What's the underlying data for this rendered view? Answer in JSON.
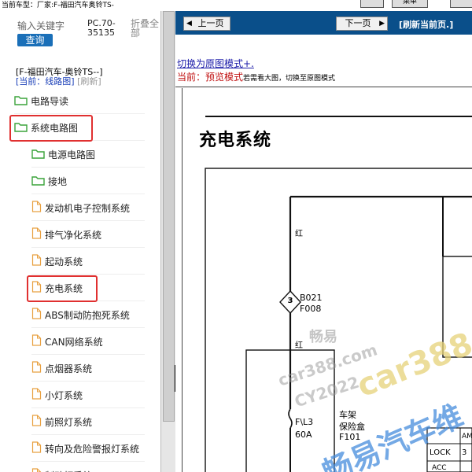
{
  "top": {
    "car_label": "当前车型：厂家:F-福田汽车奥铃TS-",
    "menu_label": "菜单"
  },
  "search": {
    "placeholder": "输入关键字",
    "query_button": "查询"
  },
  "model": {
    "line1": "PC.70-",
    "line2": "35135"
  },
  "fold": {
    "line1": "折叠全",
    "line2": "部"
  },
  "crumb": {
    "line1": "[F-福田汽车-奥铃TS--]",
    "current": "[当前：线路图]",
    "refresh": "[刷新]"
  },
  "tree": [
    {
      "label": "电路导读",
      "icon": "folder-icon"
    },
    {
      "label": "系统电路图",
      "icon": "folder-icon"
    },
    {
      "label": "电源电路图",
      "icon": "folder-icon"
    },
    {
      "label": "接地",
      "icon": "folder-icon"
    },
    {
      "label": "发动机电子控制系统",
      "icon": "page-icon"
    },
    {
      "label": "排气净化系统",
      "icon": "page-icon"
    },
    {
      "label": "起动系统",
      "icon": "page-icon"
    },
    {
      "label": "充电系统",
      "icon": "page-icon"
    },
    {
      "label": "ABS制动防抱死系统",
      "icon": "page-icon"
    },
    {
      "label": "CAN网络系统",
      "icon": "page-icon"
    },
    {
      "label": "点烟器系统",
      "icon": "page-icon"
    },
    {
      "label": "小灯系统",
      "icon": "page-icon"
    },
    {
      "label": "前照灯系统",
      "icon": "page-icon"
    },
    {
      "label": "转向及危险警报灯系统",
      "icon": "page-icon"
    },
    {
      "label": "制动灯系统",
      "icon": "page-icon"
    }
  ],
  "nav": {
    "prev": "上一页",
    "next": "下一页",
    "refresh": "[刷新当前页.]"
  },
  "mode": {
    "switch_link": "切换为原图模式+.",
    "preview_label": "当前：预览模式",
    "preview_hint": "若需看大图，切换至原图模式"
  },
  "diagram": {
    "title": "充电系统",
    "wire_color_red": "红",
    "connector_number": "3",
    "connector_b": "B021",
    "connector_f": "F008",
    "fuse_name": "F\\L3",
    "fuse_rating": "60A",
    "fusebox_line1": "车架",
    "fusebox_line2": "保险盒",
    "fusebox_code": "F101",
    "switch_lock": "LOCK",
    "switch_am": "AM",
    "switch_acc": "ACC",
    "switch_val": "3"
  },
  "watermark": {
    "line1": "畅易",
    "line2": "car388.com",
    "line3": "CY2022",
    "big": "car388.c",
    "cn": "畅易汽车维"
  },
  "colors": {
    "accent_blue": "#0a4f8a",
    "button_blue": "#1a6fb8",
    "highlight_red": "#e03030",
    "folder_green": "#3aa33a",
    "page_orange": "#e8a040"
  }
}
